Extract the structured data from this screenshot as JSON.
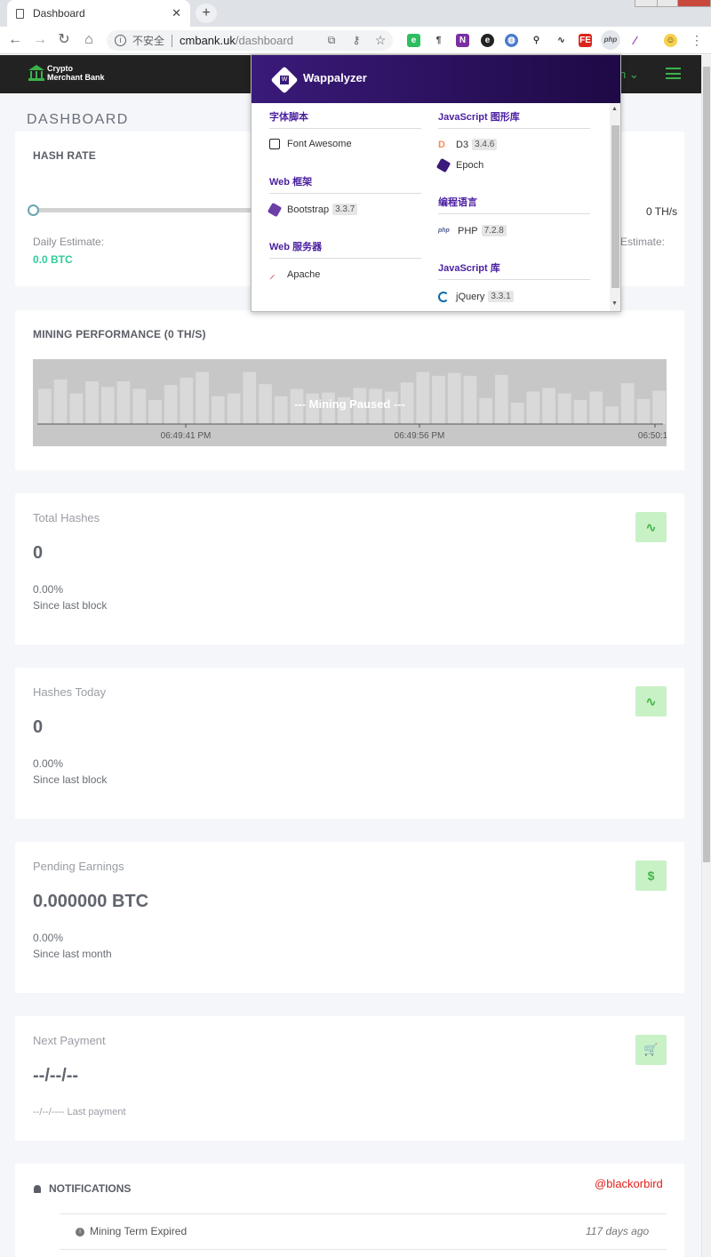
{
  "browser": {
    "tab_title": "Dashboard",
    "tab_close": "✕",
    "new_tab": "+",
    "insecure_label": "不安全",
    "url_host": "cmbank.uk",
    "url_path": "/dashboard",
    "back": "←",
    "forward": "→",
    "reload": "↻",
    "home": "⌂"
  },
  "site": {
    "logo_line1": "Crypto",
    "logo_line2": "Merchant Bank",
    "nav_user_tail": "n ⌄"
  },
  "page": {
    "title": "DASHBOARD"
  },
  "hash_rate": {
    "title": "HASH RATE",
    "slider_value_fraction": 0,
    "readout": "0 TH/s",
    "daily_label": "Daily Estimate:",
    "daily_value": "0.0 BTC",
    "right_label_fragment": "Estimate:"
  },
  "mining": {
    "title": "MINING PERFORMANCE (0 TH/S)",
    "overlay": "--- Mining Paused ---"
  },
  "chart_data": {
    "type": "bar",
    "title": "",
    "x_ticks": [
      "06:49:41 PM",
      "06:49:56 PM",
      "06:50:11"
    ],
    "values": [
      38,
      48,
      33,
      46,
      40,
      46,
      38,
      26,
      42,
      50,
      56,
      30,
      33,
      56,
      43,
      30,
      38,
      33,
      34,
      29,
      39,
      38,
      35,
      45,
      56,
      52,
      55,
      52,
      28,
      53,
      23,
      35,
      39,
      33,
      26,
      35,
      19,
      44,
      27,
      36
    ],
    "ylim": [
      0,
      70
    ],
    "grid": false
  },
  "stats": [
    {
      "label": "Total Hashes",
      "value": "0",
      "pct": "0.00%",
      "since": "Since last block",
      "icon": "pulse-icon",
      "icon_glyph": "∿"
    },
    {
      "label": "Hashes Today",
      "value": "0",
      "pct": "0.00%",
      "since": "Since last block",
      "icon": "pulse-icon",
      "icon_glyph": "∿"
    },
    {
      "label": "Pending Earnings",
      "value": "0.000000 BTC",
      "pct": "0.00%",
      "since": "Since last month",
      "icon": "dollar-icon",
      "icon_glyph": "$"
    }
  ],
  "next_payment": {
    "label": "Next Payment",
    "value": "--/--/--",
    "last": "--/--/---- Last payment",
    "icon_glyph": "🛒"
  },
  "notifications": {
    "title": "NOTIFICATIONS",
    "handle": "@blackorbird",
    "items": [
      {
        "text": "Mining Term Expired",
        "time": "117 days ago"
      }
    ]
  },
  "wappalyzer": {
    "brand": "Wappalyzer",
    "left": [
      {
        "category": "字体脚本",
        "apps": [
          {
            "name": "Font Awesome",
            "version": ""
          }
        ]
      },
      {
        "category": "Web 框架",
        "apps": [
          {
            "name": "Bootstrap",
            "version": "3.3.7"
          }
        ]
      },
      {
        "category": "Web 服务器",
        "apps": [
          {
            "name": "Apache",
            "version": ""
          }
        ]
      }
    ],
    "right": [
      {
        "category": "JavaScript 图形库",
        "apps": [
          {
            "name": "D3",
            "version": "3.4.6"
          },
          {
            "name": "Epoch",
            "version": ""
          }
        ]
      },
      {
        "category": "编程语言",
        "apps": [
          {
            "name": "PHP",
            "version": "7.2.8"
          }
        ]
      },
      {
        "category": "JavaScript 库",
        "apps": [
          {
            "name": "jQuery",
            "version": "3.3.1"
          }
        ]
      }
    ]
  },
  "colors": {
    "accent_green": "#3bb34a",
    "btc_green": "#2ecc9a",
    "wappalyzer_purple": "#3a1a7a",
    "handle_red": "#e0201b"
  }
}
